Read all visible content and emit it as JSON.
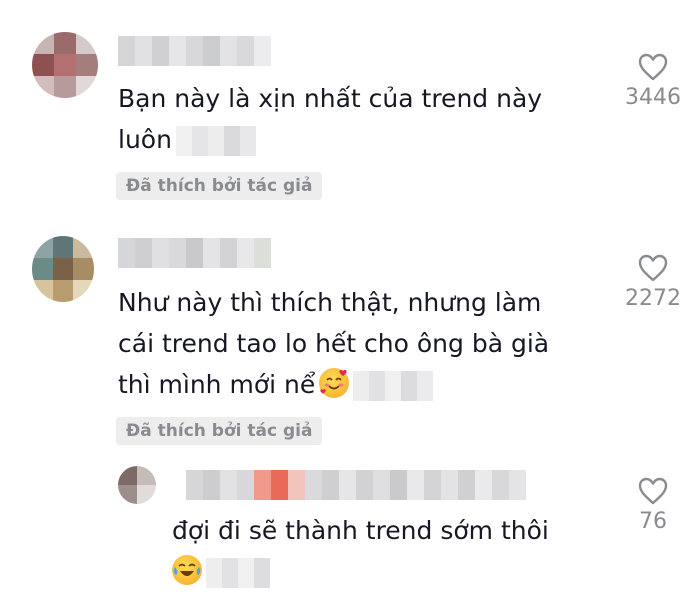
{
  "comments": [
    {
      "text_lines": [
        "Bạn này là xịn nhất của trend này",
        "luôn"
      ],
      "badge": "Đã thích bởi tác giả",
      "likes": "3446"
    },
    {
      "text_lines": [
        "Như này thì thích thật, nhưng làm",
        "cái trend tao lo hết cho ông bà già",
        "thì mình mới nể"
      ],
      "badge": "Đã thích bởi tác giả",
      "likes": "2272",
      "emoji_icon": "smiling-face-with-hearts-icon"
    }
  ],
  "reply": {
    "text_lines": [
      "đợi đi sẽ thành trend sớm thôi"
    ],
    "likes": "76",
    "emoji_icon": "face-with-tears-of-joy-icon"
  },
  "colors": {
    "text": "#161823",
    "muted": "#8a8b91",
    "badge_bg": "#ededed"
  }
}
